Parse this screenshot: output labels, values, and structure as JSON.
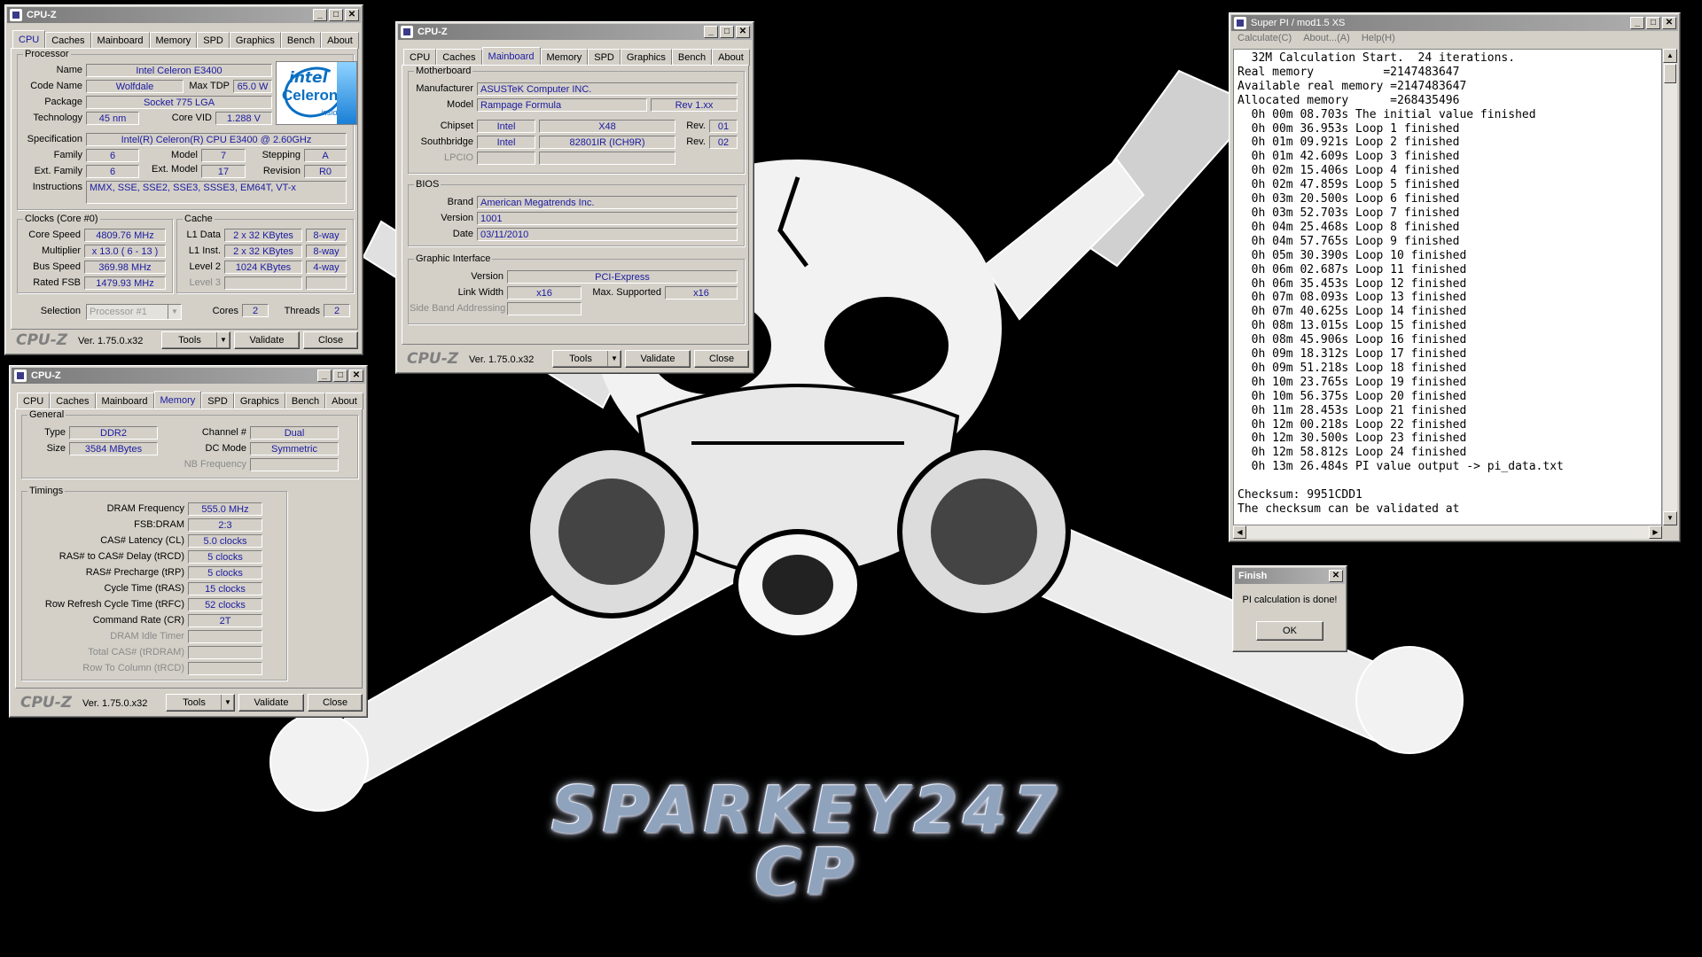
{
  "wallpaper": {
    "brand_line1": "SPARKEY247",
    "brand_line2": "CP"
  },
  "common": {
    "tabs": [
      "CPU",
      "Caches",
      "Mainboard",
      "Memory",
      "SPD",
      "Graphics",
      "Bench",
      "About"
    ],
    "logo": "CPU-Z",
    "version": "Ver. 1.75.0.x32",
    "tools": "Tools",
    "validate": "Validate",
    "close": "Close",
    "min": "_",
    "max": "□",
    "x": "✕"
  },
  "cpu_window": {
    "title": "CPU-Z",
    "processor_legend": "Processor",
    "name_label": "Name",
    "name": "Intel Celeron E3400",
    "codename_label": "Code Name",
    "codename": "Wolfdale",
    "maxtdp_label": "Max TDP",
    "maxtdp": "65.0 W",
    "package_label": "Package",
    "package": "Socket 775 LGA",
    "technology_label": "Technology",
    "technology": "45 nm",
    "corevid_label": "Core VID",
    "corevid": "1.288 V",
    "spec_label": "Specification",
    "spec": "Intel(R) Celeron(R) CPU      E3400  @ 2.60GHz",
    "family_label": "Family",
    "family": "6",
    "model_label": "Model",
    "model": "7",
    "stepping_label": "Stepping",
    "stepping": "A",
    "extfamily_label": "Ext. Family",
    "extfamily": "6",
    "extmodel_label": "Ext. Model",
    "extmodel": "17",
    "revision_label": "Revision",
    "revision": "R0",
    "instructions_label": "Instructions",
    "instructions": "MMX, SSE, SSE2, SSE3, SSSE3, EM64T, VT-x",
    "clocks_legend": "Clocks (Core #0)",
    "corespeed_label": "Core Speed",
    "corespeed": "4809.76 MHz",
    "multiplier_label": "Multiplier",
    "multiplier": "x 13.0 ( 6 - 13 )",
    "busspeed_label": "Bus Speed",
    "busspeed": "369.98 MHz",
    "ratedfsb_label": "Rated FSB",
    "ratedfsb": "1479.93 MHz",
    "cache_legend": "Cache",
    "l1data_label": "L1 Data",
    "l1data": "2 x 32 KBytes",
    "l1data_way": "8-way",
    "l1inst_label": "L1 Inst.",
    "l1inst": "2 x 32 KBytes",
    "l1inst_way": "8-way",
    "level2_label": "Level 2",
    "level2": "1024 KBytes",
    "level2_way": "4-way",
    "level3_label": "Level 3",
    "selection_label": "Selection",
    "selection": "Processor #1",
    "cores_label": "Cores",
    "cores": "2",
    "threads_label": "Threads",
    "threads": "2",
    "intel_brand": "intel",
    "intel_line": "Celeron",
    "intel_inside": "inside"
  },
  "mainboard_window": {
    "title": "CPU-Z",
    "mb_legend": "Motherboard",
    "manufacturer_label": "Manufacturer",
    "manufacturer": "ASUSTeK Computer INC.",
    "model_label": "Model",
    "model": "Rampage Formula",
    "model_rev": "Rev 1.xx",
    "chipset_label": "Chipset",
    "chipset_vendor": "Intel",
    "chipset": "X48",
    "chipset_rev_label": "Rev.",
    "chipset_rev": "01",
    "southbridge_label": "Southbridge",
    "sb_vendor": "Intel",
    "sb": "82801IR (ICH9R)",
    "sb_rev_label": "Rev.",
    "sb_rev": "02",
    "lpcio_label": "LPCIO",
    "bios_legend": "BIOS",
    "brand_label": "Brand",
    "brand": "American Megatrends Inc.",
    "version_label": "Version",
    "version": "1001",
    "date_label": "Date",
    "date": "03/11/2010",
    "gi_legend": "Graphic Interface",
    "giversion_label": "Version",
    "giversion": "PCI-Express",
    "linkwidth_label": "Link Width",
    "linkwidth": "x16",
    "maxsupported_label": "Max. Supported",
    "maxsupported": "x16",
    "sideband_label": "Side Band Addressing"
  },
  "memory_window": {
    "title": "CPU-Z",
    "general_legend": "General",
    "type_label": "Type",
    "type": "DDR2",
    "channel_label": "Channel #",
    "channel": "Dual",
    "size_label": "Size",
    "size": "3584 MBytes",
    "dcmode_label": "DC Mode",
    "dcmode": "Symmetric",
    "nbfreq_label": "NB Frequency",
    "timings_legend": "Timings",
    "dramfreq_label": "DRAM Frequency",
    "dramfreq": "555.0 MHz",
    "fsbdram_label": "FSB:DRAM",
    "fsbdram": "2:3",
    "cl_label": "CAS# Latency (CL)",
    "cl": "5.0 clocks",
    "trcd_label": "RAS# to CAS# Delay (tRCD)",
    "trcd": "5 clocks",
    "trp_label": "RAS# Precharge (tRP)",
    "trp": "5 clocks",
    "tras_label": "Cycle Time (tRAS)",
    "tras": "15 clocks",
    "trfc_label": "Row Refresh Cycle Time (tRFC)",
    "trfc": "52 clocks",
    "cr_label": "Command Rate (CR)",
    "cr": "2T",
    "idle_label": "DRAM Idle Timer",
    "trdram_label": "Total CAS# (tRDRAM)",
    "trcd2_label": "Row To Column (tRCD)"
  },
  "superpi": {
    "title": "Super PI / mod1.5 XS",
    "menu": [
      "Calculate(C)",
      "About...(A)",
      "Help(H)"
    ],
    "lines": [
      "  32M Calculation Start.  24 iterations.",
      "Real memory          =2147483647",
      "Available real memory =2147483647",
      "Allocated memory      =268435496",
      "  0h 00m 08.703s The initial value finished",
      "  0h 00m 36.953s Loop 1 finished",
      "  0h 01m 09.921s Loop 2 finished",
      "  0h 01m 42.609s Loop 3 finished",
      "  0h 02m 15.406s Loop 4 finished",
      "  0h 02m 47.859s Loop 5 finished",
      "  0h 03m 20.500s Loop 6 finished",
      "  0h 03m 52.703s Loop 7 finished",
      "  0h 04m 25.468s Loop 8 finished",
      "  0h 04m 57.765s Loop 9 finished",
      "  0h 05m 30.390s Loop 10 finished",
      "  0h 06m 02.687s Loop 11 finished",
      "  0h 06m 35.453s Loop 12 finished",
      "  0h 07m 08.093s Loop 13 finished",
      "  0h 07m 40.625s Loop 14 finished",
      "  0h 08m 13.015s Loop 15 finished",
      "  0h 08m 45.906s Loop 16 finished",
      "  0h 09m 18.312s Loop 17 finished",
      "  0h 09m 51.218s Loop 18 finished",
      "  0h 10m 23.765s Loop 19 finished",
      "  0h 10m 56.375s Loop 20 finished",
      "  0h 11m 28.453s Loop 21 finished",
      "  0h 12m 00.218s Loop 22 finished",
      "  0h 12m 30.500s Loop 23 finished",
      "  0h 12m 58.812s Loop 24 finished",
      "  0h 13m 26.484s PI value output -> pi_data.txt",
      "",
      "Checksum: 9951CDD1",
      "The checksum can be validated at"
    ]
  },
  "finish_dialog": {
    "title": "Finish",
    "message": "PI calculation is done!",
    "ok": "OK"
  }
}
